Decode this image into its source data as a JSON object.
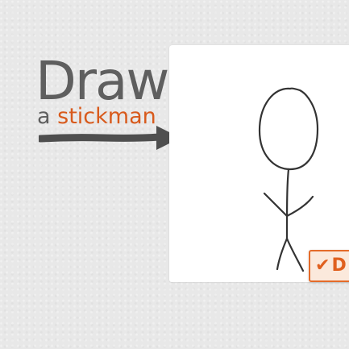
{
  "logo": {
    "title": "Draw",
    "subtitle_prefix": "a",
    "subtitle_accent": "stickman"
  },
  "done_button": {
    "check_glyph": "✔",
    "label": "D"
  },
  "colors": {
    "background": "#e8e8e8",
    "logo_text": "#5f5f5f",
    "accent": "#d85a1c",
    "canvas": "#ffffff",
    "ink": "#333333"
  },
  "icons": [
    "arrow-right-icon",
    "check-icon"
  ]
}
